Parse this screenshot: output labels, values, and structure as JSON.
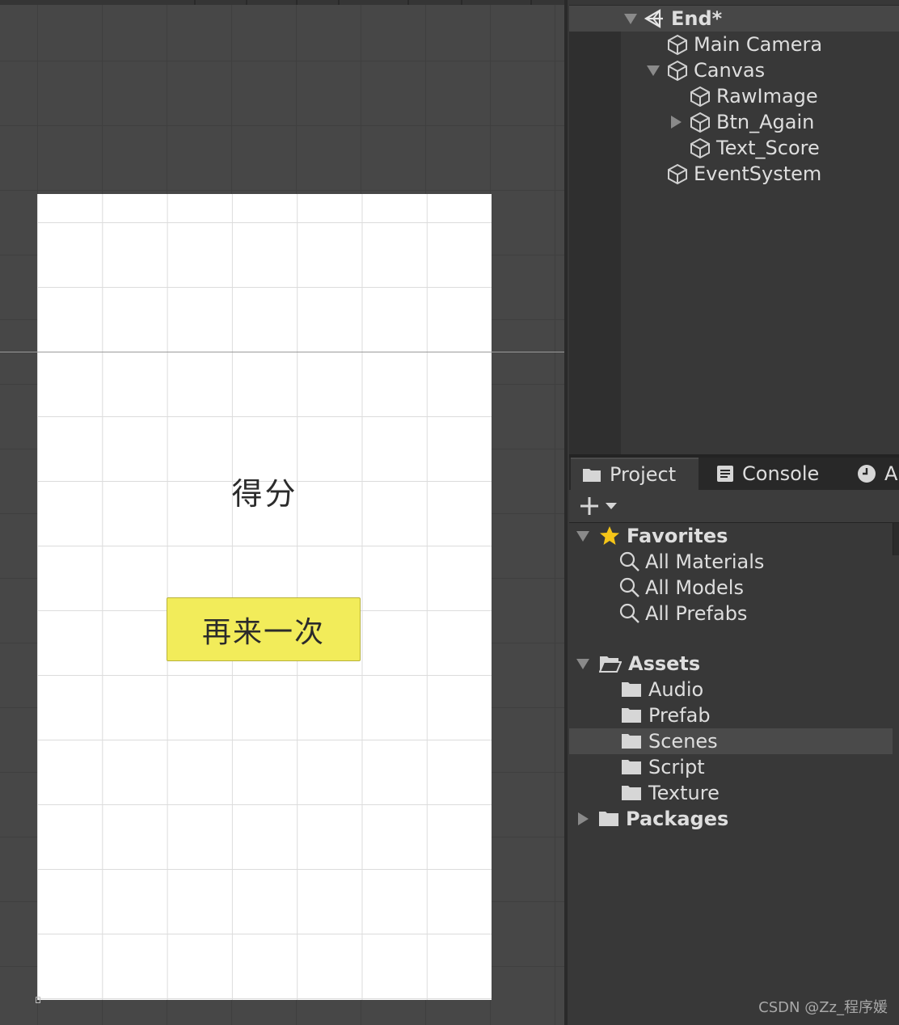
{
  "scene": {
    "score_label": "得分",
    "again_button_label": "再来一次"
  },
  "hierarchy": {
    "scene_name": "End*",
    "items": [
      {
        "label": "Main Camera"
      },
      {
        "label": "Canvas"
      },
      {
        "label": "RawImage"
      },
      {
        "label": "Btn_Again"
      },
      {
        "label": "Text_Score"
      },
      {
        "label": "EventSystem"
      }
    ]
  },
  "project": {
    "tabs": [
      {
        "label": "Project",
        "icon": "folder-icon"
      },
      {
        "label": "Console",
        "icon": "console-icon"
      },
      {
        "label": "Ar",
        "icon": "clock-icon"
      }
    ],
    "favorites": {
      "label": "Favorites",
      "items": [
        {
          "label": "All Materials"
        },
        {
          "label": "All Models"
        },
        {
          "label": "All Prefabs"
        }
      ]
    },
    "assets": {
      "label": "Assets",
      "items": [
        {
          "label": "Audio"
        },
        {
          "label": "Prefab"
        },
        {
          "label": "Scenes",
          "selected": true
        },
        {
          "label": "Script"
        },
        {
          "label": "Texture"
        }
      ]
    },
    "packages_label": "Packages"
  },
  "watermark": "CSDN @Zz_程序媛",
  "colors": {
    "button_yellow": "#f2ec5a",
    "panel_bg": "#383838",
    "scene_bg": "#474747",
    "star": "#f5c518"
  }
}
